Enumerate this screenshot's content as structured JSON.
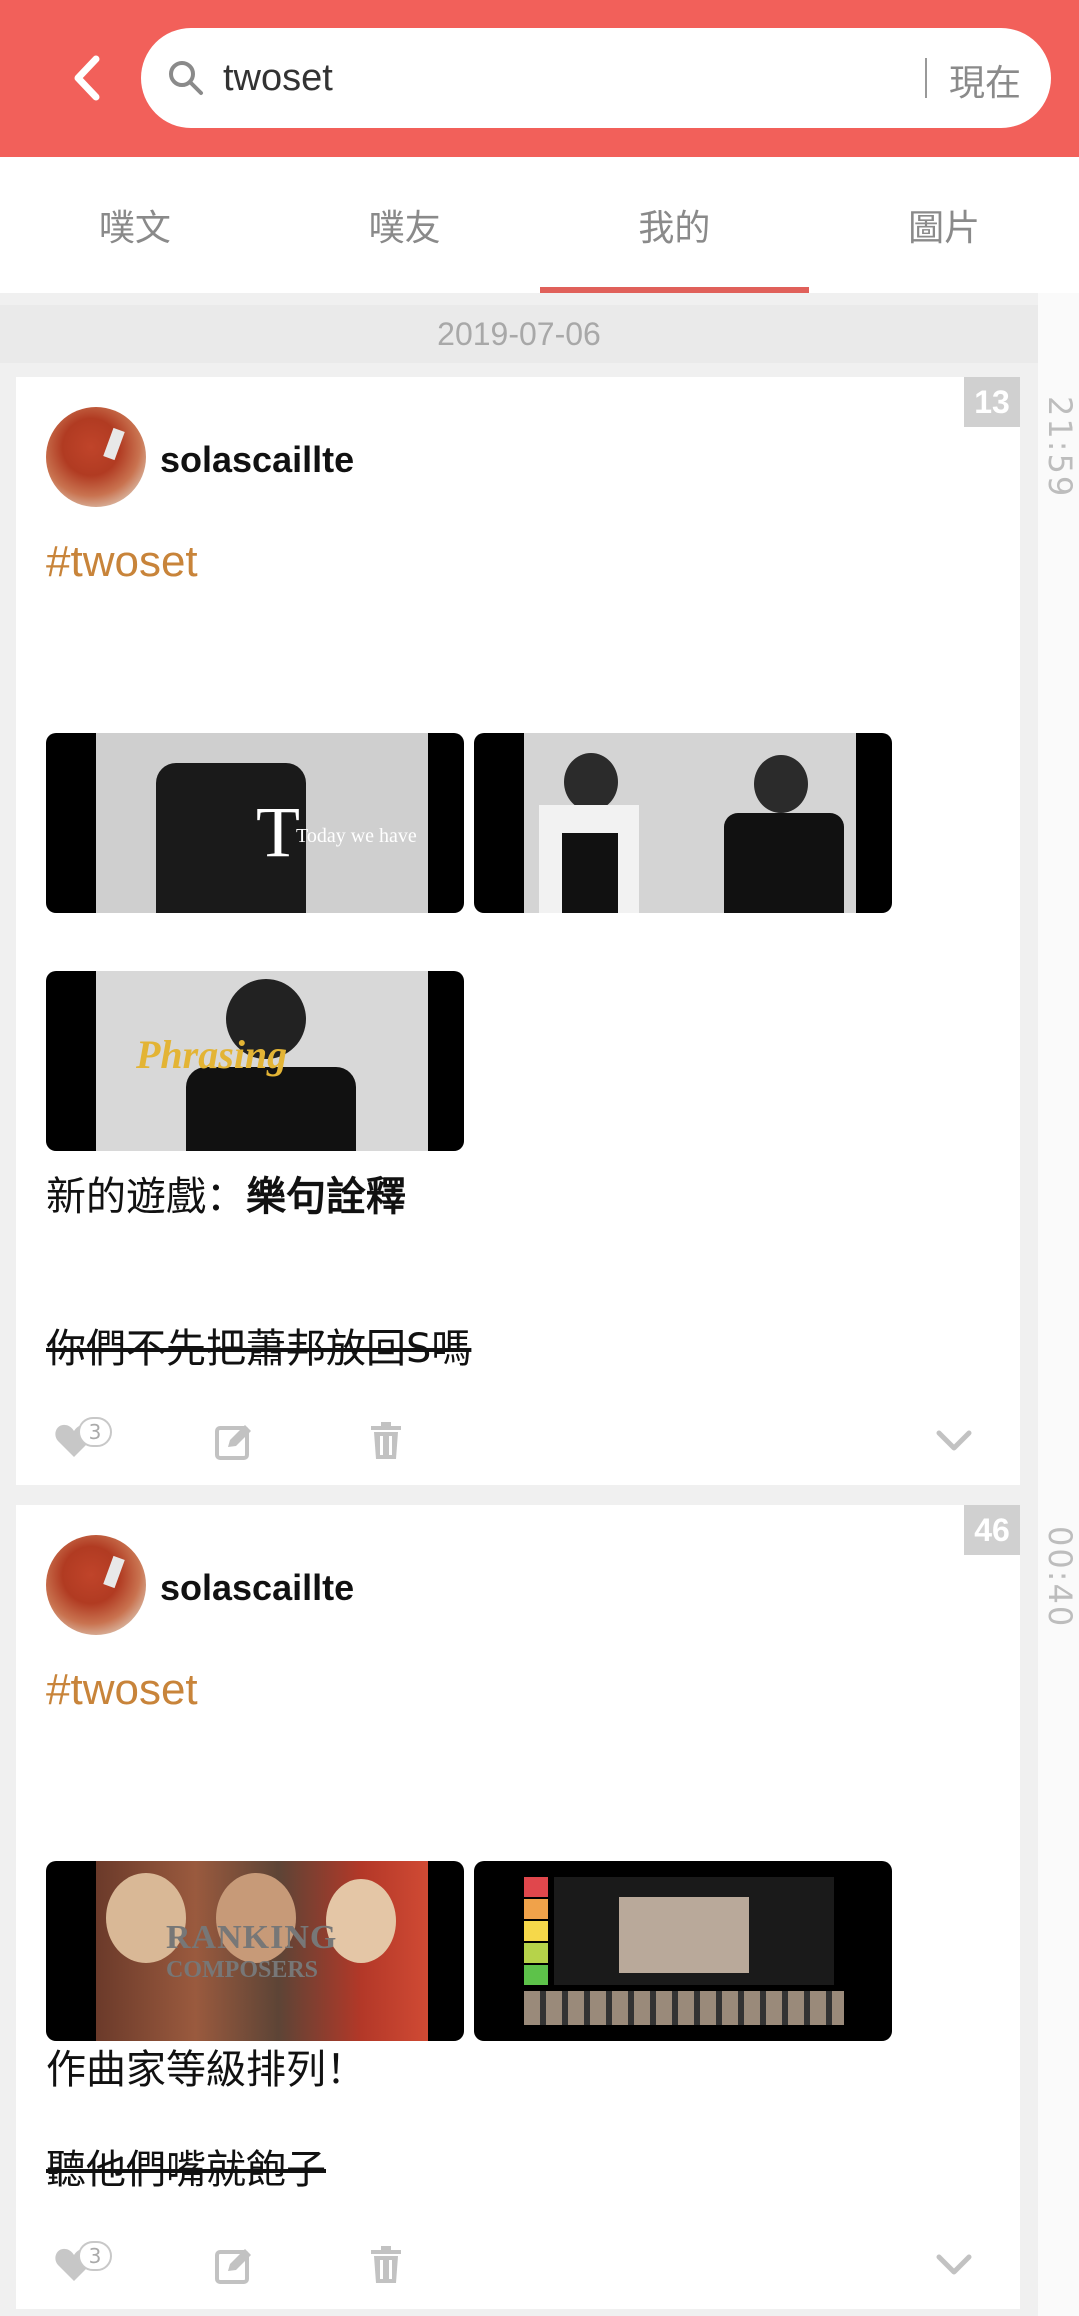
{
  "header": {
    "search_value": "twoset",
    "search_placeholder": "twoset",
    "time_filter": "現在"
  },
  "tabs": [
    {
      "label": "噗文",
      "active": false
    },
    {
      "label": "噗友",
      "active": false
    },
    {
      "label": "我的",
      "active": true
    },
    {
      "label": "圖片",
      "active": false
    }
  ],
  "date_separator": "2019-07-06",
  "posts": [
    {
      "response_count": "13",
      "time": "21:59",
      "author": "solascaillte",
      "hashtag": "#twoset",
      "image_captions": [
        "Today we have",
        "Phrasing"
      ],
      "text_prefix": "新的遊戲：",
      "text_bold": "樂句詮釋",
      "strike_text": "你們不先把蕭邦放回S嗎",
      "likes": "3"
    },
    {
      "response_count": "46",
      "time": "00:40",
      "author": "solascaillte",
      "hashtag": "#twoset",
      "image_captions": [
        "RANKING",
        "COMPOSERS"
      ],
      "text": "作曲家等級排列！",
      "strike_text": "聽他們嘴就飽子",
      "likes": "3"
    }
  ],
  "colors": {
    "header_bg": "#f2605a",
    "tab_indicator": "#e0605a",
    "hashtag": "#c8843a"
  },
  "icons": {
    "back": "chevron-left-icon",
    "search": "magnifier-icon",
    "like": "heart-icon",
    "edit": "edit-icon",
    "delete": "trash-icon",
    "expand": "chevron-down-icon"
  }
}
